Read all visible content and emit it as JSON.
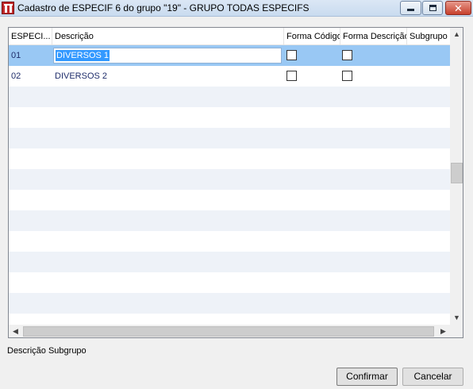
{
  "window": {
    "title": "Cadastro de ESPECIF 6 do grupo \"19\" - GRUPO TODAS ESPECIFS",
    "minimize_icon": "minimize-icon",
    "maximize_icon": "maximize-icon",
    "close_icon": "close-icon"
  },
  "grid": {
    "columns": [
      "ESPECI...",
      "Descrição",
      "Forma Código",
      "Forma Descrição",
      "Subgrupo"
    ],
    "rows": [
      {
        "especif": "01",
        "descricao": "DIVERSOS 1",
        "forma_codigo": false,
        "forma_descricao": false,
        "subgrupo": "",
        "selected": true
      },
      {
        "especif": "02",
        "descricao": "DIVERSOS 2",
        "forma_codigo": false,
        "forma_descricao": false,
        "subgrupo": "",
        "selected": false
      }
    ],
    "selection_color": "#99c8f4",
    "alt_row_color": "#eef2f8"
  },
  "status": {
    "label": "Descrição Subgrupo"
  },
  "buttons": {
    "confirm": "Confirmar",
    "cancel": "Cancelar"
  }
}
